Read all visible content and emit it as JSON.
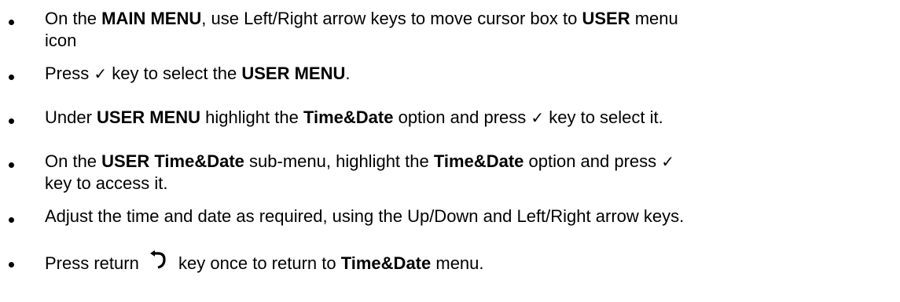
{
  "instructions": {
    "items": [
      {
        "line1_a": "On the ",
        "line1_b": "MAIN MENU",
        "line1_c": ", use Left/Right arrow keys to move cursor box to ",
        "line1_d": "USER",
        "line1_e": " menu",
        "line2": "icon"
      },
      {
        "a": "Press ",
        "check": "✓",
        "b": " key to select the ",
        "c": "USER MENU",
        "d": "."
      },
      {
        "a": "Under ",
        "b": "USER MENU",
        "c": " highlight the ",
        "d": "Time&Date",
        "e": " option and press ",
        "check": "✓",
        "f": " key to select it."
      },
      {
        "line1_a": "On the ",
        "line1_b": "USER Time&Date",
        "line1_c": " sub-menu, highlight the ",
        "line1_d": "Time&Date",
        "line1_e": " option and press ",
        "check": "✓",
        "line2": "key to access it."
      },
      {
        "text": "Adjust the time and date as required, using the Up/Down and Left/Right arrow keys."
      },
      {
        "a": "Press return ",
        "icon": "return-arrow-icon",
        "b": " key once to return to ",
        "c": "Time&Date",
        "d": " menu."
      }
    ]
  }
}
